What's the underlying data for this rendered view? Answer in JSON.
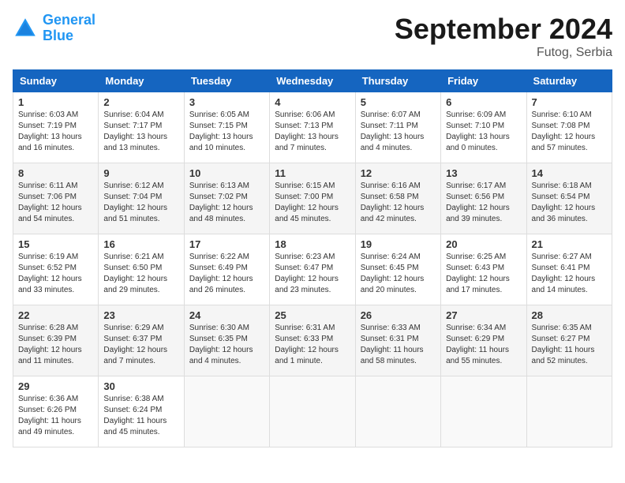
{
  "header": {
    "logo_line1": "General",
    "logo_line2": "Blue",
    "month_title": "September 2024",
    "location": "Futog, Serbia"
  },
  "weekdays": [
    "Sunday",
    "Monday",
    "Tuesday",
    "Wednesday",
    "Thursday",
    "Friday",
    "Saturday"
  ],
  "weeks": [
    [
      {
        "day": "1",
        "info": "Sunrise: 6:03 AM\nSunset: 7:19 PM\nDaylight: 13 hours\nand 16 minutes."
      },
      {
        "day": "2",
        "info": "Sunrise: 6:04 AM\nSunset: 7:17 PM\nDaylight: 13 hours\nand 13 minutes."
      },
      {
        "day": "3",
        "info": "Sunrise: 6:05 AM\nSunset: 7:15 PM\nDaylight: 13 hours\nand 10 minutes."
      },
      {
        "day": "4",
        "info": "Sunrise: 6:06 AM\nSunset: 7:13 PM\nDaylight: 13 hours\nand 7 minutes."
      },
      {
        "day": "5",
        "info": "Sunrise: 6:07 AM\nSunset: 7:11 PM\nDaylight: 13 hours\nand 4 minutes."
      },
      {
        "day": "6",
        "info": "Sunrise: 6:09 AM\nSunset: 7:10 PM\nDaylight: 13 hours\nand 0 minutes."
      },
      {
        "day": "7",
        "info": "Sunrise: 6:10 AM\nSunset: 7:08 PM\nDaylight: 12 hours\nand 57 minutes."
      }
    ],
    [
      {
        "day": "8",
        "info": "Sunrise: 6:11 AM\nSunset: 7:06 PM\nDaylight: 12 hours\nand 54 minutes."
      },
      {
        "day": "9",
        "info": "Sunrise: 6:12 AM\nSunset: 7:04 PM\nDaylight: 12 hours\nand 51 minutes."
      },
      {
        "day": "10",
        "info": "Sunrise: 6:13 AM\nSunset: 7:02 PM\nDaylight: 12 hours\nand 48 minutes."
      },
      {
        "day": "11",
        "info": "Sunrise: 6:15 AM\nSunset: 7:00 PM\nDaylight: 12 hours\nand 45 minutes."
      },
      {
        "day": "12",
        "info": "Sunrise: 6:16 AM\nSunset: 6:58 PM\nDaylight: 12 hours\nand 42 minutes."
      },
      {
        "day": "13",
        "info": "Sunrise: 6:17 AM\nSunset: 6:56 PM\nDaylight: 12 hours\nand 39 minutes."
      },
      {
        "day": "14",
        "info": "Sunrise: 6:18 AM\nSunset: 6:54 PM\nDaylight: 12 hours\nand 36 minutes."
      }
    ],
    [
      {
        "day": "15",
        "info": "Sunrise: 6:19 AM\nSunset: 6:52 PM\nDaylight: 12 hours\nand 33 minutes."
      },
      {
        "day": "16",
        "info": "Sunrise: 6:21 AM\nSunset: 6:50 PM\nDaylight: 12 hours\nand 29 minutes."
      },
      {
        "day": "17",
        "info": "Sunrise: 6:22 AM\nSunset: 6:49 PM\nDaylight: 12 hours\nand 26 minutes."
      },
      {
        "day": "18",
        "info": "Sunrise: 6:23 AM\nSunset: 6:47 PM\nDaylight: 12 hours\nand 23 minutes."
      },
      {
        "day": "19",
        "info": "Sunrise: 6:24 AM\nSunset: 6:45 PM\nDaylight: 12 hours\nand 20 minutes."
      },
      {
        "day": "20",
        "info": "Sunrise: 6:25 AM\nSunset: 6:43 PM\nDaylight: 12 hours\nand 17 minutes."
      },
      {
        "day": "21",
        "info": "Sunrise: 6:27 AM\nSunset: 6:41 PM\nDaylight: 12 hours\nand 14 minutes."
      }
    ],
    [
      {
        "day": "22",
        "info": "Sunrise: 6:28 AM\nSunset: 6:39 PM\nDaylight: 12 hours\nand 11 minutes."
      },
      {
        "day": "23",
        "info": "Sunrise: 6:29 AM\nSunset: 6:37 PM\nDaylight: 12 hours\nand 7 minutes."
      },
      {
        "day": "24",
        "info": "Sunrise: 6:30 AM\nSunset: 6:35 PM\nDaylight: 12 hours\nand 4 minutes."
      },
      {
        "day": "25",
        "info": "Sunrise: 6:31 AM\nSunset: 6:33 PM\nDaylight: 12 hours\nand 1 minute."
      },
      {
        "day": "26",
        "info": "Sunrise: 6:33 AM\nSunset: 6:31 PM\nDaylight: 11 hours\nand 58 minutes."
      },
      {
        "day": "27",
        "info": "Sunrise: 6:34 AM\nSunset: 6:29 PM\nDaylight: 11 hours\nand 55 minutes."
      },
      {
        "day": "28",
        "info": "Sunrise: 6:35 AM\nSunset: 6:27 PM\nDaylight: 11 hours\nand 52 minutes."
      }
    ],
    [
      {
        "day": "29",
        "info": "Sunrise: 6:36 AM\nSunset: 6:26 PM\nDaylight: 11 hours\nand 49 minutes."
      },
      {
        "day": "30",
        "info": "Sunrise: 6:38 AM\nSunset: 6:24 PM\nDaylight: 11 hours\nand 45 minutes."
      },
      {
        "day": "",
        "info": ""
      },
      {
        "day": "",
        "info": ""
      },
      {
        "day": "",
        "info": ""
      },
      {
        "day": "",
        "info": ""
      },
      {
        "day": "",
        "info": ""
      }
    ]
  ]
}
